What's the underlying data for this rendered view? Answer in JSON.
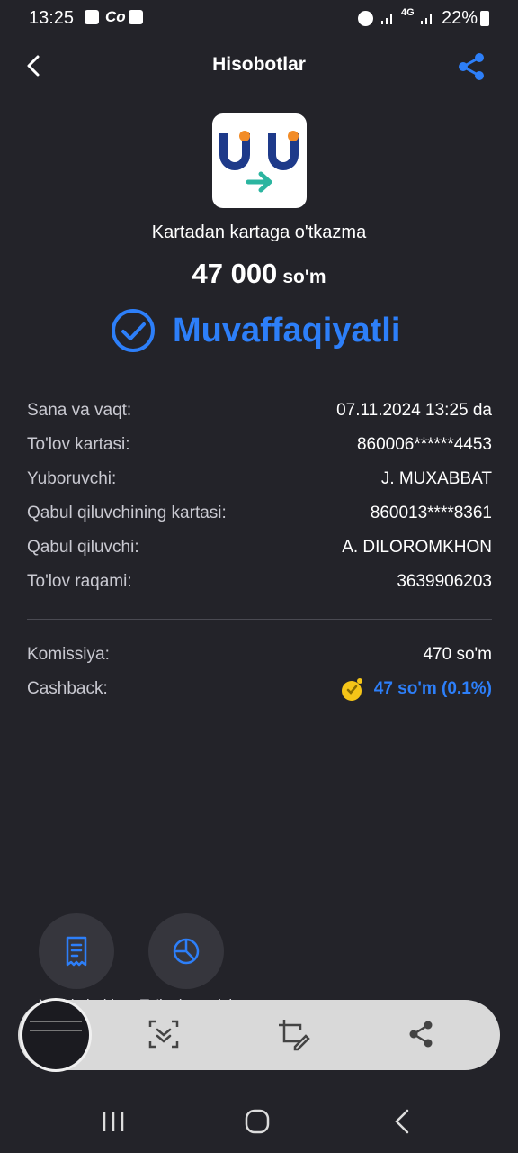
{
  "status_bar": {
    "time": "13:25",
    "battery_pct": "22%",
    "network": "4G"
  },
  "header": {
    "title": "Hisobotlar"
  },
  "transfer": {
    "type_label": "Kartadan kartaga o'tkazma",
    "amount": "47 000",
    "currency": "so'm",
    "status": "Muvaffaqiyatli"
  },
  "details": [
    {
      "label": "Sana va vaqt:",
      "value": "07.11.2024 13:25 da"
    },
    {
      "label": "To'lov kartasi:",
      "value": "860006******4453"
    },
    {
      "label": "Yuboruvchi:",
      "value": "J. MUXABBAT"
    },
    {
      "label": "Qabul qiluvchining kartasi:",
      "value": "860013****8361"
    },
    {
      "label": "Qabul qiluvchi:",
      "value": "A. DILOROMKHON"
    },
    {
      "label": "To'lov raqami:",
      "value": "3639906203"
    }
  ],
  "fees": [
    {
      "label": "Komissiya:",
      "value": "470 so'm"
    },
    {
      "label": "Cashback:",
      "value": "47 so'm (0.1%)"
    }
  ],
  "actions": [
    {
      "label": "Xarid cheki",
      "icon": "receipt-icon"
    },
    {
      "label": "To'lovlar tarixi",
      "icon": "pie-chart-icon"
    }
  ],
  "colors": {
    "background": "#232329",
    "accent": "#2d7ff9",
    "logo_orange": "#f28c28",
    "logo_navy": "#1e3a8a",
    "logo_teal": "#2bb5a0"
  }
}
